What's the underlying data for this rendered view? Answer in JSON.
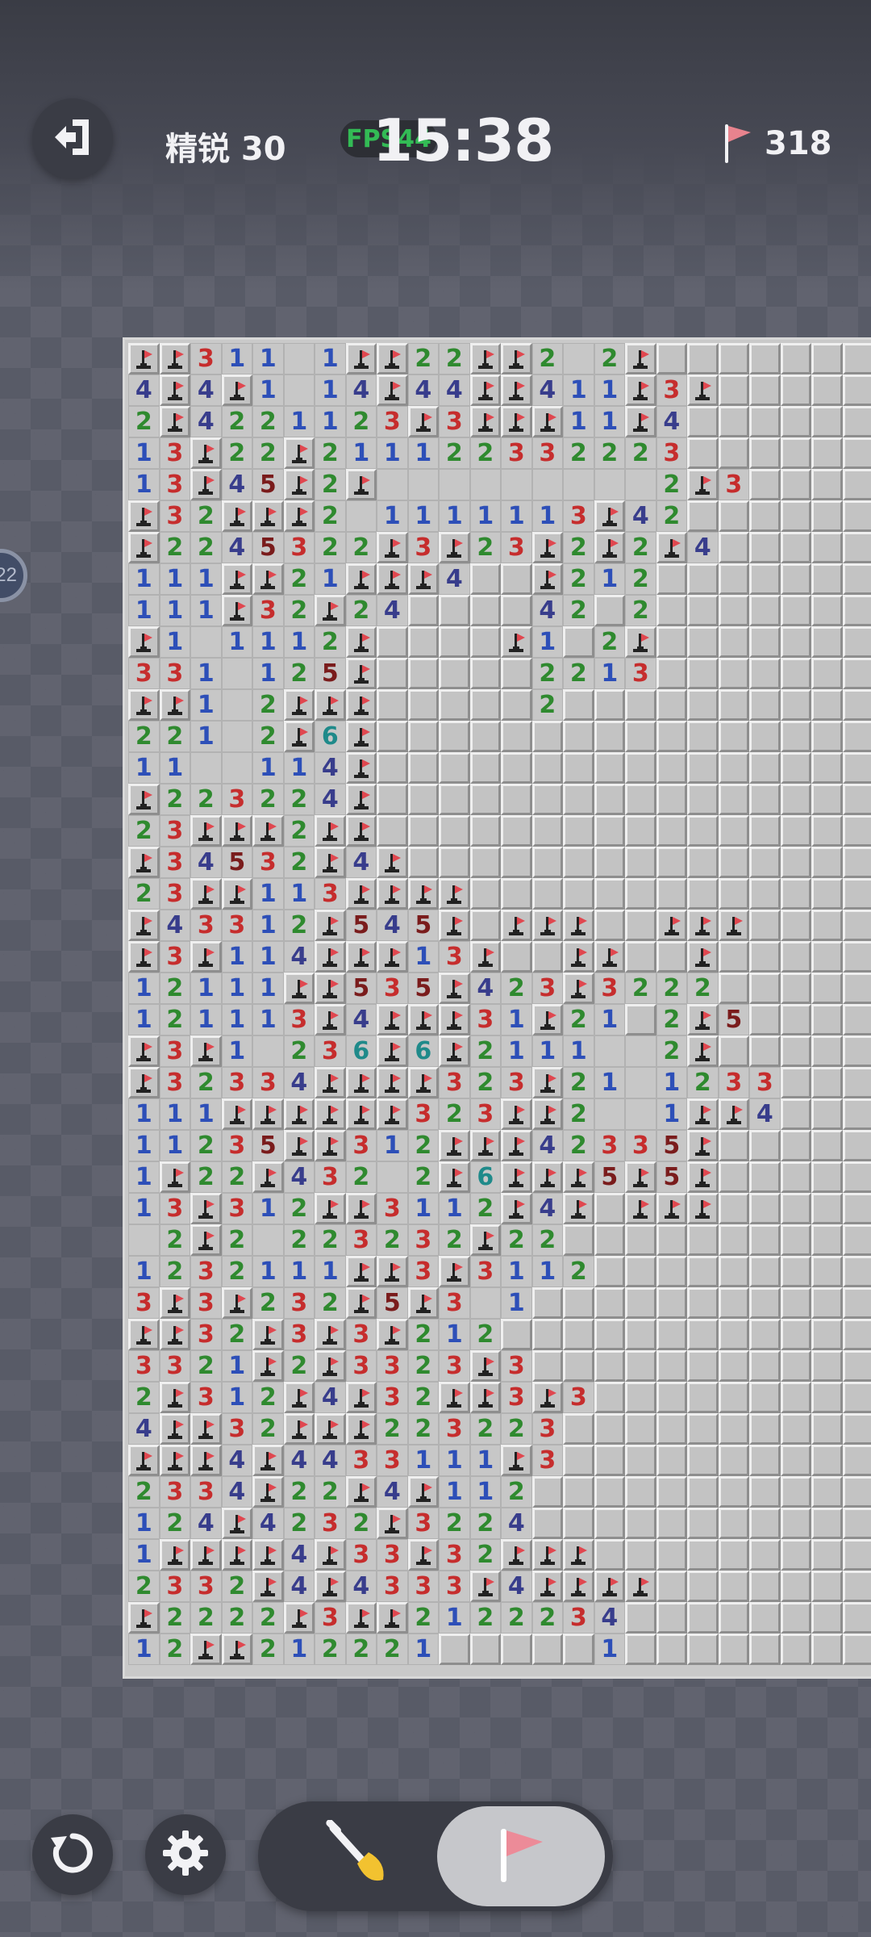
{
  "hud": {
    "level": "精锐 30",
    "fps": "FPS44",
    "timer": "15:38",
    "flags_remaining": "318",
    "side_badge": "22"
  },
  "board": {
    "columns": 24,
    "rows_count": 42,
    "legend": "F = flag, U = unopened, . = opened blank, digit = number",
    "rows": [
      "FF311.1FF22FF2.2FUUUUUUU",
      "4F4F1.14F44FF411F3FUUUUU",
      "2F4221123F3FFF11F4UUUUUU",
      "13F22F211122332223UUUUUU",
      "13F45F2F.........2F3UUUU",
      "F32FFF2.1111113F42UUUUUU",
      "F2245322F3F23F2F2F4UUUUU",
      "111FF21FFF4UUF212UUUUUUU",
      "111F32F24UUUU42U2UUUUUUU",
      "F1.1112FUUUUF1U2FUUUUUUU",
      "331.125FUUUUU2213UUUUUUU",
      "FF1.2FFFUUUUU2UUUUUUUUUU",
      "221.2F6FUUUUUUUUUUUUUUUU",
      "11..114FUUUUUUUUUUUUUUUU",
      "F223224FUUUUUUUUUUUUUUUU",
      "23FFF2FFUUUUUUUUUUUUUUUU",
      "F34532F4FUUUUUUUUUUUUUUU",
      "23FF113FFFFUUUUUUUUUUUUU",
      "F43312F545FUFFFUUFFFUUUU",
      "F3F114FFF13FUUFFUUFUUUUU",
      "12111FF535F423F3222UUUUU",
      "121113F4FFF31F21U2F5UUUU",
      "F3F1.236F6F2111..2FUUUUU",
      "F32334FFFF323F21.1233UUU",
      "111FFFFFF323FF2..1FF4UUU",
      "11235FF312FFF42335FUUUUU",
      "1F22F432.2F6FFF5F5FUUUUU",
      "13F312FF3112F4FUFFFUUUUU",
      ".2F2.223232F22UUUUUUUUUU",
      "1232111FF3F3112UUUUUUUUU",
      "3F3F232F5F3.1UUUUUUUUUUU",
      "FF32F3F3F212UUUUUUUUUUUU",
      "3321F2F3323F3UUUUUUUUUUU",
      "2F312F4F32FF3F3UUUUUUUUU",
      "4FF32FFF223223UUUUUUUUUU",
      "FFF4F4433111F3UUUUUUUUUU",
      "2334F22F4F112UUUUUUUUUUU",
      "124F4232F3224UUUUUUUUUUU",
      "1FFFF4F33F32FFFUUUUUUUUU",
      "2332F4F4333F4FFFFUUUUUUU",
      "F2222F3FF2122234UUUUUUUU",
      "12FF212221UUUUU1UUUUUUUU"
    ]
  },
  "controls": {
    "exit": "exit-icon",
    "undo": "undo-icon",
    "settings": "gear-icon",
    "dig_mode": "shovel-icon",
    "flag_mode": "flag-icon",
    "active_mode": "flag"
  },
  "colors": {
    "n1": "#2d4fb8",
    "n2": "#2f8a2f",
    "n3": "#c62d2d",
    "n4": "#383d8c",
    "n5": "#7a1c1c",
    "n6": "#1f8a8a",
    "flag": "#e0474f",
    "shovel_tip": "#f2c230"
  }
}
